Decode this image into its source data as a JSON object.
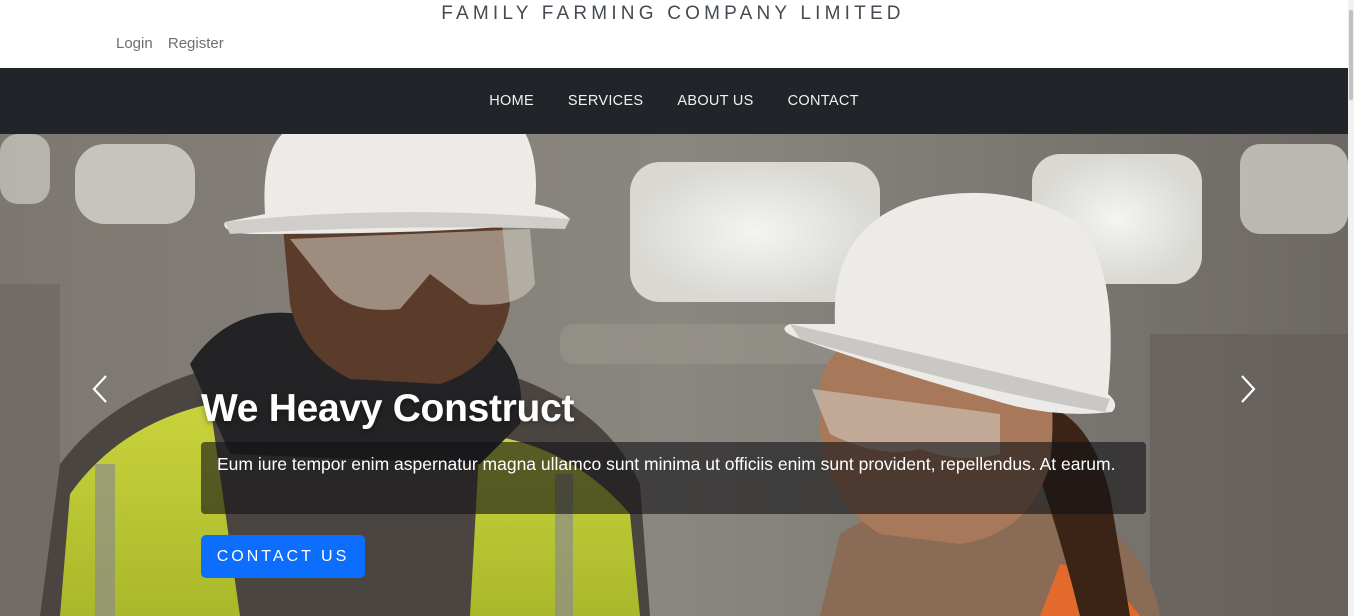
{
  "header": {
    "brand": "FAMILY FARMING COMPANY LIMITED",
    "auth_links": [
      {
        "label": "Login"
      },
      {
        "label": "Register"
      }
    ]
  },
  "nav": {
    "items": [
      {
        "label": "HOME"
      },
      {
        "label": "SERVICES"
      },
      {
        "label": "ABOUT US"
      },
      {
        "label": "CONTACT"
      }
    ]
  },
  "hero": {
    "title": "We Heavy Construct",
    "description": "Eum iure tempor enim aspernatur magna ullamco sunt minima ut officiis enim sunt provident, repellendus. At earum.",
    "cta_label": "CONTACT US",
    "prev_icon": "chevron-left-icon",
    "next_icon": "chevron-right-icon"
  },
  "colors": {
    "navbar_bg": "#212529",
    "cta_bg": "#0d6efd",
    "brand_text": "#444b52"
  }
}
